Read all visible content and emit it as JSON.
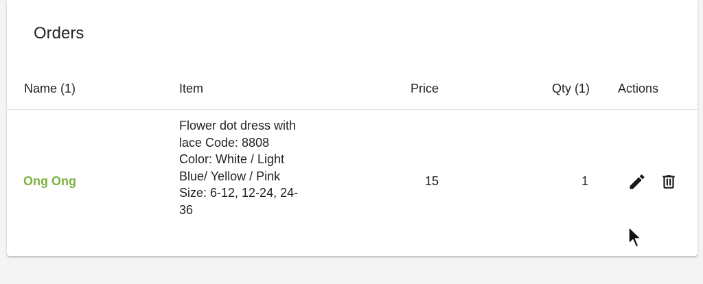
{
  "card": {
    "title": "Orders"
  },
  "table": {
    "headers": {
      "name": "Name (1)",
      "item": "Item",
      "price": "Price",
      "qty": "Qty (1)",
      "actions": "Actions"
    },
    "rows": [
      {
        "name": "Ong Ong",
        "item": "Flower dot dress with lace Code: 8808 Color: White / Light Blue/ Yellow / Pink Size: 6-12, 12-24, 24-36",
        "price": "15",
        "qty": "1",
        "actions": [
          "pencil-icon",
          "trash-icon"
        ]
      }
    ]
  },
  "colors": {
    "name_accent": "#7cb342",
    "card_bg": "#ffffff",
    "page_bg": "#f4f4f4"
  }
}
